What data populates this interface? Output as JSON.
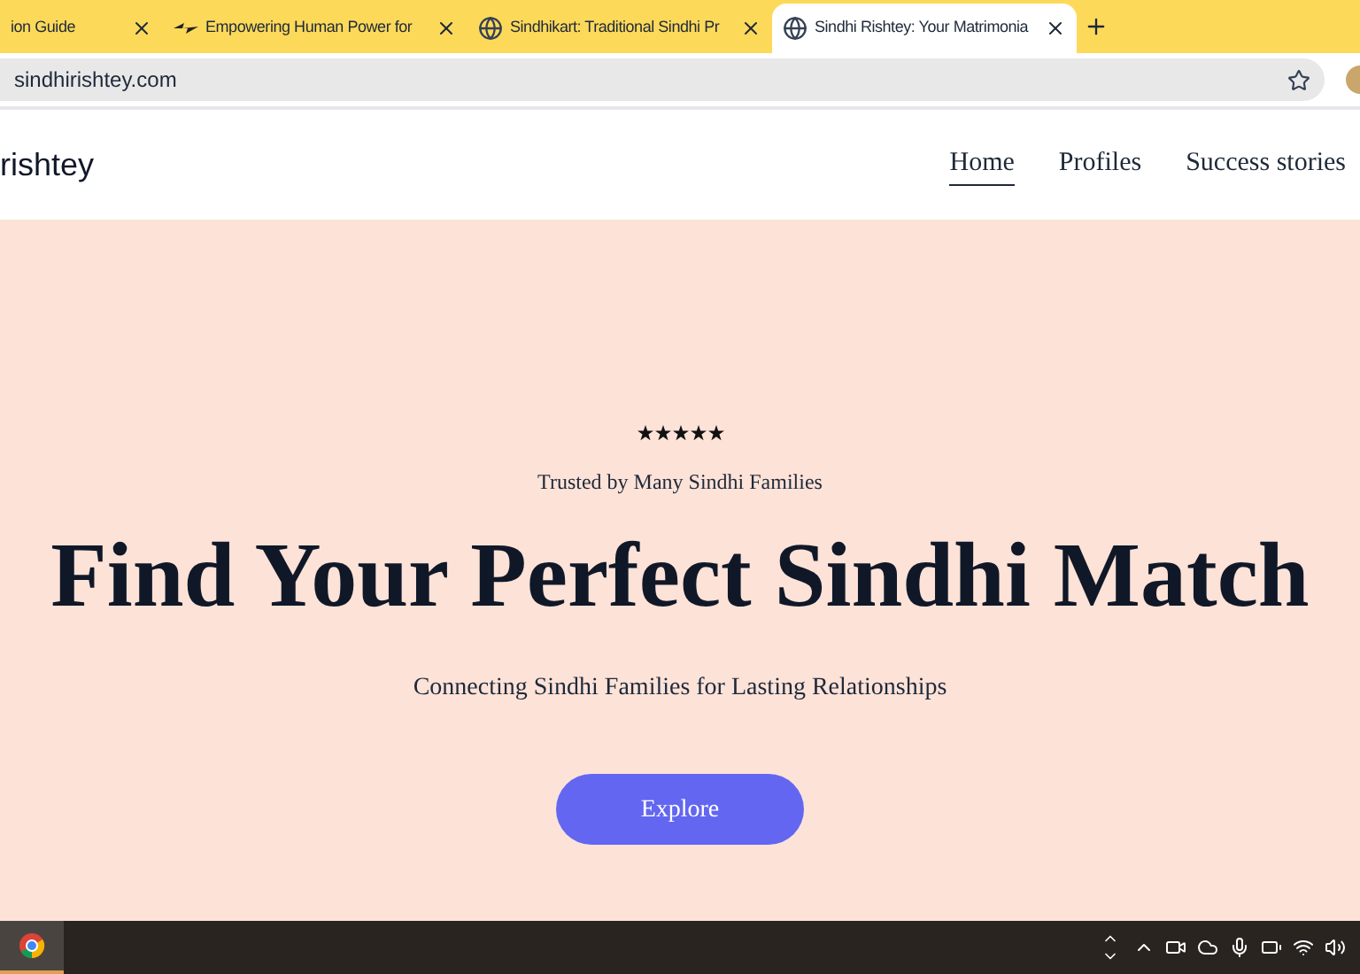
{
  "browser": {
    "tabs": [
      {
        "title": "ion Guide",
        "kind": "none",
        "selected": false
      },
      {
        "title": "Empowering Human Power for",
        "kind": "logo",
        "selected": false
      },
      {
        "title": "Sindhikart: Traditional Sindhi Pr",
        "kind": "globe",
        "selected": false
      },
      {
        "title": "Sindhi Rishtey: Your Matrimonia",
        "kind": "globe",
        "selected": true
      }
    ],
    "url": "sindhirishtey.com"
  },
  "header": {
    "logo": "rishtey",
    "nav": [
      {
        "label": "Home",
        "selected": true
      },
      {
        "label": "Profiles",
        "selected": false
      },
      {
        "label": "Success stories",
        "selected": false
      }
    ]
  },
  "hero": {
    "stars": 5,
    "tagline": "Trusted by Many Sindhi Families",
    "title": "Find Your Perfect Sindhi Match",
    "subtitle": "Connecting Sindhi Families for Lasting Relationships",
    "button": "Explore"
  }
}
